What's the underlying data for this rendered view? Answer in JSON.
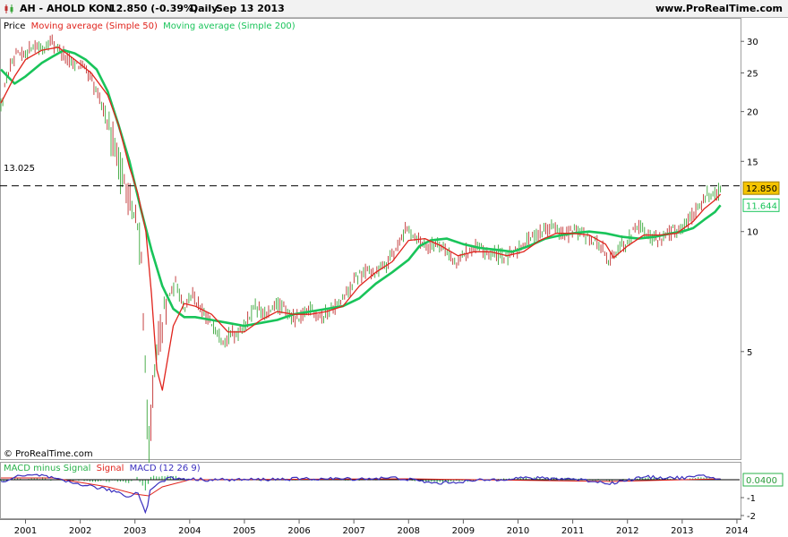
{
  "header": {
    "symbol_line": "AH - AHOLD KON",
    "price_change": "12.850 (-0.39%)",
    "period": "Daily",
    "date": "Sep 13 2013",
    "site": "www.ProRealTime.com"
  },
  "legend": {
    "price": "Price",
    "ma50": "Moving average (Simple 50)",
    "ma200": "Moving average (Simple 200)"
  },
  "copyright": "© ProRealTime.com",
  "price_badge": "12.850",
  "ma200_badge": "11.644",
  "hline_label": "13.025",
  "macd_legend": {
    "part1": "MACD minus Signal",
    "part2": "Signal",
    "part3": "MACD (12 26 9)"
  },
  "macd_badge": "0.0400",
  "colors": {
    "ma50": "#e0231c",
    "ma200": "#19c45a",
    "candle_up": "#3aa63a",
    "candle_down": "#c03030",
    "macd": "#3a2fbf",
    "signal": "#e0231c",
    "histogram": "#29b24a",
    "price_badge_bg": "#f5c400"
  },
  "chart_data": [
    {
      "type": "line",
      "scale": "log",
      "ylim": [
        2.7,
        34
      ],
      "yticks": [
        {
          "value": 30,
          "label": "30"
        },
        {
          "value": 25,
          "label": "25"
        },
        {
          "value": 20,
          "label": "20"
        },
        {
          "value": 15,
          "label": "15"
        },
        {
          "value": 10,
          "label": "10"
        },
        {
          "value": 5,
          "label": "5"
        }
      ],
      "xlim": [
        2000.55,
        2014.05
      ],
      "xticks": [
        {
          "value": 2001,
          "label": "2001"
        },
        {
          "value": 2002,
          "label": "2002"
        },
        {
          "value": 2003,
          "label": "2003"
        },
        {
          "value": 2004,
          "label": "2004"
        },
        {
          "value": 2005,
          "label": "2005"
        },
        {
          "value": 2006,
          "label": "2006"
        },
        {
          "value": 2007,
          "label": "2007"
        },
        {
          "value": 2008,
          "label": "2008"
        },
        {
          "value": 2009,
          "label": "2009"
        },
        {
          "value": 2010,
          "label": "2010"
        },
        {
          "value": 2011,
          "label": "2011"
        },
        {
          "value": 2012,
          "label": "2012"
        },
        {
          "value": 2013,
          "label": "2013"
        },
        {
          "value": 2014,
          "label": "2014"
        }
      ],
      "horizontal_line": 13.025,
      "price": {
        "x": [
          2000.55,
          2000.7,
          2000.85,
          2001.0,
          2001.15,
          2001.3,
          2001.45,
          2001.6,
          2001.75,
          2001.9,
          2002.05,
          2002.2,
          2002.35,
          2002.5,
          2002.6,
          2002.7,
          2002.8,
          2002.9,
          2002.95,
          2003.05,
          2003.12,
          2003.16,
          2003.2,
          2003.26,
          2003.3,
          2003.35,
          2003.45,
          2003.6,
          2003.75,
          2003.9,
          2004.05,
          2004.2,
          2004.4,
          2004.6,
          2004.8,
          2005.0,
          2005.2,
          2005.4,
          2005.6,
          2005.8,
          2006.0,
          2006.2,
          2006.4,
          2006.6,
          2006.8,
          2007.0,
          2007.2,
          2007.4,
          2007.6,
          2007.8,
          2007.95,
          2008.05,
          2008.2,
          2008.4,
          2008.55,
          2008.7,
          2008.85,
          2009.0,
          2009.2,
          2009.4,
          2009.6,
          2009.8,
          2010.0,
          2010.2,
          2010.4,
          2010.6,
          2010.8,
          2011.0,
          2011.2,
          2011.4,
          2011.55,
          2011.65,
          2011.8,
          2012.0,
          2012.2,
          2012.4,
          2012.6,
          2012.8,
          2013.0,
          2013.2,
          2013.35,
          2013.5,
          2013.6,
          2013.7
        ],
        "y": [
          20.5,
          25.5,
          27.5,
          28.0,
          29.5,
          28.5,
          30.0,
          29.0,
          27.0,
          26.5,
          26.0,
          24.0,
          21.5,
          19.0,
          17.0,
          15.0,
          13.5,
          12.0,
          11.0,
          10.3,
          8.5,
          6.0,
          3.6,
          2.9,
          3.5,
          4.2,
          5.5,
          6.8,
          7.4,
          6.5,
          7.0,
          6.3,
          5.9,
          5.4,
          5.5,
          5.8,
          6.5,
          6.1,
          6.6,
          6.2,
          6.0,
          6.5,
          6.1,
          6.4,
          6.7,
          7.5,
          8.0,
          7.9,
          8.3,
          9.2,
          10.2,
          10.0,
          9.5,
          9.2,
          9.4,
          9.0,
          8.2,
          8.8,
          9.1,
          8.9,
          8.8,
          8.6,
          9.0,
          9.6,
          10.0,
          10.4,
          9.8,
          10.0,
          9.9,
          9.5,
          9.0,
          8.3,
          9.0,
          9.5,
          10.5,
          9.7,
          9.6,
          10.0,
          10.2,
          11.0,
          11.9,
          12.5,
          12.2,
          12.85
        ]
      },
      "ma50": {
        "x": [
          2000.55,
          2000.8,
          2001.0,
          2001.3,
          2001.6,
          2001.9,
          2002.2,
          2002.5,
          2002.7,
          2002.9,
          2003.05,
          2003.2,
          2003.3,
          2003.4,
          2003.5,
          2003.7,
          2003.9,
          2004.1,
          2004.4,
          2004.7,
          2005.0,
          2005.3,
          2005.6,
          2005.9,
          2006.2,
          2006.5,
          2006.8,
          2007.1,
          2007.4,
          2007.7,
          2008.0,
          2008.3,
          2008.6,
          2008.9,
          2009.2,
          2009.5,
          2009.8,
          2010.1,
          2010.4,
          2010.7,
          2011.0,
          2011.3,
          2011.6,
          2011.75,
          2012.0,
          2012.3,
          2012.6,
          2012.9,
          2013.2,
          2013.4,
          2013.6,
          2013.7
        ],
        "y": [
          21.0,
          24.5,
          27.0,
          28.5,
          29.0,
          27.0,
          25.0,
          22.0,
          18.5,
          14.5,
          12.5,
          10.0,
          7.0,
          4.5,
          4.0,
          5.8,
          6.6,
          6.5,
          6.2,
          5.6,
          5.6,
          6.0,
          6.3,
          6.2,
          6.2,
          6.3,
          6.5,
          7.3,
          7.9,
          8.4,
          9.5,
          9.6,
          9.2,
          8.7,
          8.9,
          8.9,
          8.7,
          8.9,
          9.5,
          9.9,
          9.9,
          9.8,
          9.3,
          8.6,
          9.2,
          9.8,
          9.8,
          9.9,
          10.6,
          11.4,
          12.0,
          12.4
        ]
      },
      "ma200": {
        "x": [
          2000.55,
          2000.8,
          2001.0,
          2001.3,
          2001.5,
          2001.7,
          2001.9,
          2002.1,
          2002.3,
          2002.5,
          2002.7,
          2002.9,
          2003.1,
          2003.3,
          2003.5,
          2003.7,
          2003.9,
          2004.1,
          2004.4,
          2004.7,
          2005.0,
          2005.3,
          2005.6,
          2005.9,
          2006.2,
          2006.5,
          2006.8,
          2007.1,
          2007.4,
          2007.7,
          2008.0,
          2008.2,
          2008.4,
          2008.7,
          2009.0,
          2009.3,
          2009.6,
          2009.9,
          2010.2,
          2010.5,
          2010.8,
          2011.0,
          2011.3,
          2011.6,
          2011.9,
          2012.2,
          2012.5,
          2012.8,
          2013.0,
          2013.2,
          2013.4,
          2013.6,
          2013.7
        ],
        "y": [
          25.5,
          23.5,
          24.5,
          26.5,
          27.5,
          28.5,
          28.0,
          27.0,
          25.5,
          22.5,
          18.5,
          15.0,
          11.5,
          9.0,
          7.3,
          6.4,
          6.1,
          6.1,
          6.0,
          5.9,
          5.8,
          5.9,
          6.0,
          6.2,
          6.3,
          6.4,
          6.5,
          6.8,
          7.4,
          7.9,
          8.5,
          9.2,
          9.5,
          9.6,
          9.3,
          9.1,
          9.0,
          8.9,
          9.2,
          9.6,
          9.8,
          9.9,
          10.0,
          9.9,
          9.7,
          9.6,
          9.7,
          9.9,
          10.0,
          10.2,
          10.7,
          11.2,
          11.644
        ]
      }
    },
    {
      "type": "line",
      "ylim": [
        -2.1,
        0.9
      ],
      "yticks": [
        {
          "value": 0,
          "label": "0"
        },
        {
          "value": -1,
          "label": "-1"
        },
        {
          "value": -2,
          "label": "-2"
        }
      ],
      "macd": {
        "x": [
          2000.55,
          2000.9,
          2001.3,
          2001.7,
          2002.1,
          2002.4,
          2002.7,
          2002.9,
          2003.05,
          2003.15,
          2003.2,
          2003.28,
          2003.4,
          2003.6,
          2003.9,
          2004.3,
          2005.0,
          2006.0,
          2007.0,
          2007.8,
          2008.5,
          2009.0,
          2010.0,
          2011.0,
          2011.7,
          2012.3,
          2013.0,
          2013.4,
          2013.7
        ],
        "y": [
          -0.1,
          0.2,
          0.25,
          -0.1,
          -0.3,
          -0.5,
          -0.7,
          -1.0,
          -0.6,
          -1.5,
          -2.0,
          -0.5,
          -0.3,
          0.1,
          0.05,
          0.0,
          0.0,
          0.05,
          0.05,
          0.1,
          -0.2,
          -0.1,
          0.1,
          0.05,
          -0.2,
          0.15,
          0.1,
          0.2,
          0.04
        ]
      },
      "signal": {
        "x": [
          2000.55,
          2001.5,
          2002.5,
          2003.0,
          2003.25,
          2003.5,
          2004.0,
          2008.0,
          2011.7,
          2013.7
        ],
        "y": [
          0.1,
          0.1,
          -0.4,
          -0.8,
          -0.9,
          -0.4,
          0.0,
          0.05,
          -0.1,
          0.05
        ]
      }
    }
  ]
}
